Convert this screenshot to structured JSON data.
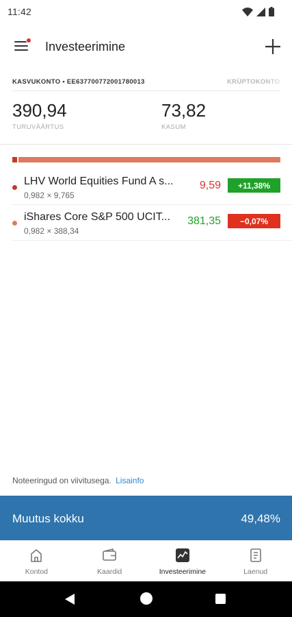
{
  "status_bar": {
    "time": "11:42",
    "icons": [
      "wifi-icon",
      "signal-icon",
      "battery-icon"
    ]
  },
  "app_bar": {
    "title": "Investeerimine",
    "menu_icon": "hamburger-menu-icon",
    "add_icon": "plus-icon",
    "notification_dot_color": "#e0312b"
  },
  "accounts": {
    "active": "KASVUKONTO • EE637700772001780013",
    "other": "KRÜPTOKONTO"
  },
  "summary": {
    "market_value": {
      "value": "390,94",
      "label": "TURUVÄÄRTUS"
    },
    "profit": {
      "value": "73,82",
      "label": "KASUM"
    }
  },
  "allocation": {
    "colors": [
      "#c23b26",
      "#df7a5e"
    ]
  },
  "holdings": [
    {
      "name": "LHV World Equities Fund A s...",
      "quantity": "0,982 × 9,765",
      "price": "9,59",
      "price_color": "#e0312b",
      "change": "+11,38%",
      "change_color": "#1fa12a",
      "dot_color": "#c23b26"
    },
    {
      "name": "iShares Core S&P 500 UCIT...",
      "quantity": "0,982 × 388,34",
      "price": "381,35",
      "price_color": "#1fa12a",
      "change": "−0,07%",
      "change_color": "#e0311f",
      "dot_color": "#df7a5e"
    }
  ],
  "note": {
    "text": "Noteeringud on viivitusega.",
    "link": "Lisainfo"
  },
  "total": {
    "label": "Muutus kokku",
    "value": "49,48%",
    "color": "#2f74ad"
  },
  "bottom_nav": [
    {
      "label": "Kontod",
      "icon": "home-icon"
    },
    {
      "label": "Kaardid",
      "icon": "wallet-icon"
    },
    {
      "label": "Investeerimine",
      "icon": "chart-icon",
      "active": true
    },
    {
      "label": "Laenud",
      "icon": "document-icon"
    }
  ]
}
